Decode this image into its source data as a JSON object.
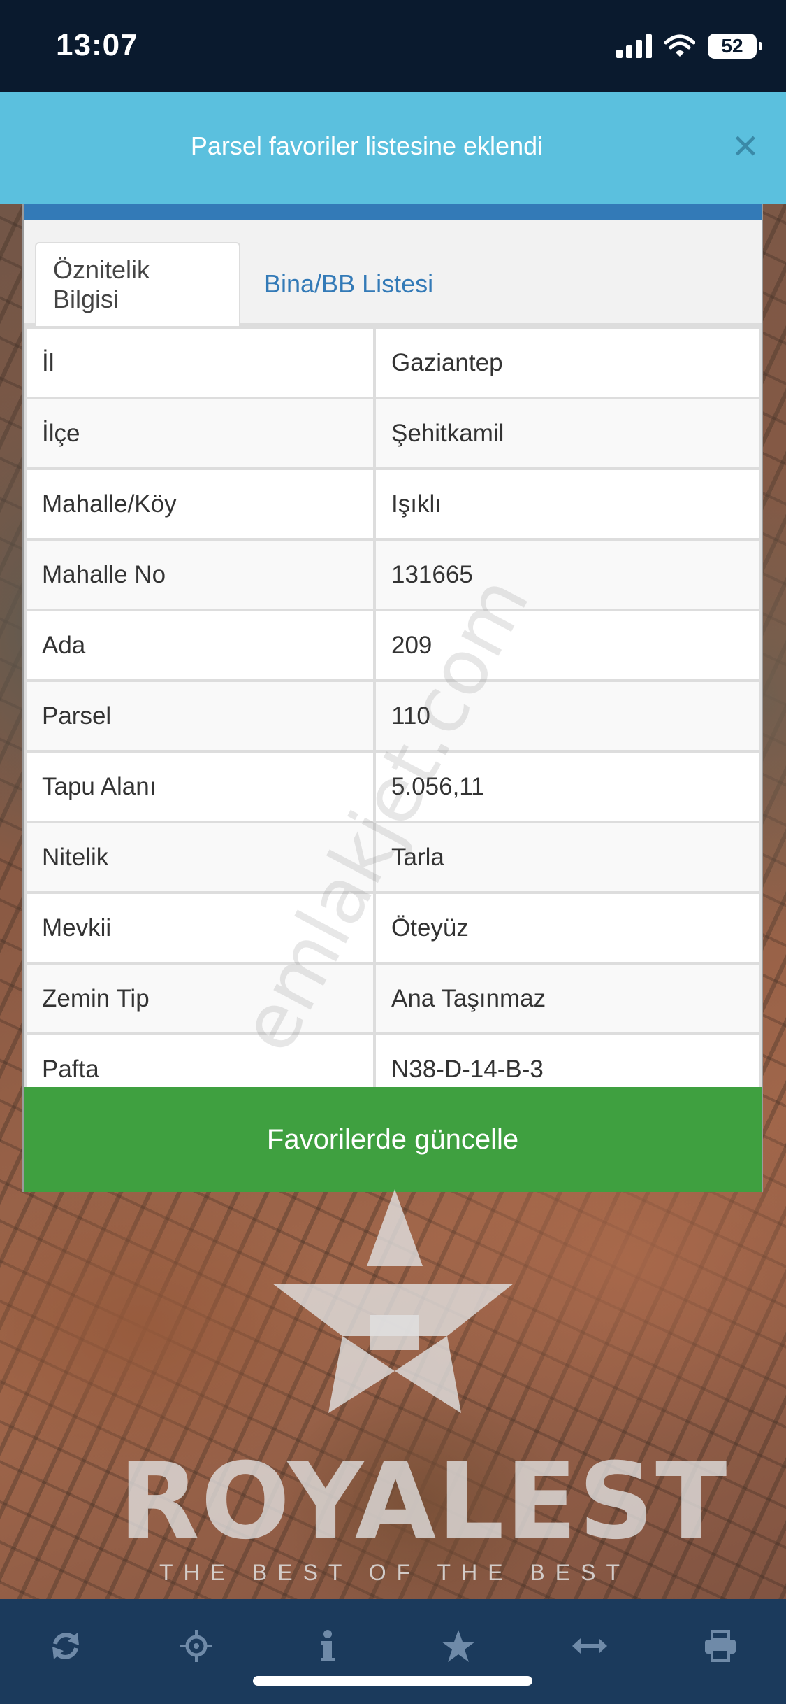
{
  "status_bar": {
    "time": "13:07",
    "battery": "52"
  },
  "toast": {
    "message": "Parsel favoriler listesine eklendi",
    "close_glyph": "✕"
  },
  "tabs": [
    {
      "label": "Öznitelik Bilgisi",
      "active": true
    },
    {
      "label": "Bina/BB Listesi",
      "active": false
    }
  ],
  "attributes": [
    {
      "key": "İl",
      "value": "Gaziantep"
    },
    {
      "key": "İlçe",
      "value": "Şehitkamil"
    },
    {
      "key": "Mahalle/Köy",
      "value": "Işıklı"
    },
    {
      "key": "Mahalle No",
      "value": "131665"
    },
    {
      "key": "Ada",
      "value": "209"
    },
    {
      "key": "Parsel",
      "value": "110"
    },
    {
      "key": "Tapu Alanı",
      "value": "5.056,11"
    },
    {
      "key": "Nitelik",
      "value": "Tarla"
    },
    {
      "key": "Mevkii",
      "value": "Öteyüz"
    },
    {
      "key": "Zemin Tip",
      "value": "Ana Taşınmaz"
    },
    {
      "key": "Pafta",
      "value": "N38-D-14-B-3"
    }
  ],
  "update_button": {
    "label": "Favorilerde güncelle"
  },
  "watermark": {
    "text": "emlakjet.com"
  },
  "logo": {
    "name": "ROYALEST",
    "tagline": "THE BEST OF THE BEST"
  },
  "bottom_nav": [
    {
      "icon": "refresh-icon"
    },
    {
      "icon": "crosshair-icon"
    },
    {
      "icon": "info-icon"
    },
    {
      "icon": "star-icon"
    },
    {
      "icon": "measure-icon"
    },
    {
      "icon": "print-icon"
    }
  ],
  "colors": {
    "toast_bg": "#5bc0de",
    "panel_accent": "#337ab7",
    "button_green": "#3fa040",
    "bottom_bar": "#1b3a5c"
  }
}
